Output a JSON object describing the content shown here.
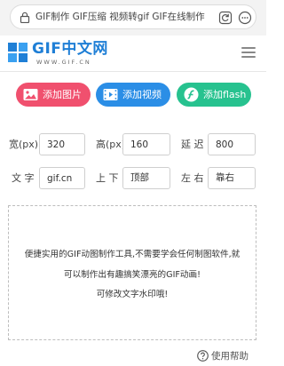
{
  "browser": {
    "url": "GIF制作 GIF压缩 视频转gif GIF在线制作"
  },
  "header": {
    "logo_text": "GIF中文网",
    "logo_sub": "WWW.GIF.CN"
  },
  "actions": {
    "add_image": "添加图片",
    "add_video": "添加视频",
    "add_flash": "添加flash"
  },
  "form": {
    "width_label": "宽(px)",
    "width_value": "320",
    "height_label": "高(px)",
    "height_value": "160",
    "delay_label": "延 迟",
    "delay_value": "800",
    "text_label": "文 字",
    "text_value": "gif.cn",
    "vpos_label": "上 下",
    "vpos_value": "顶部",
    "hpos_label": "左 右",
    "hpos_value": "靠右"
  },
  "dropzone": {
    "line1": "便捷实用的GIF动图制作工具,不需要学会任何制图软件,就",
    "line2": "可以制作出有趣搞笑漂亮的GIF动画!",
    "line3": "可修改文字水印哦!"
  },
  "help": {
    "label": "使用帮助"
  }
}
